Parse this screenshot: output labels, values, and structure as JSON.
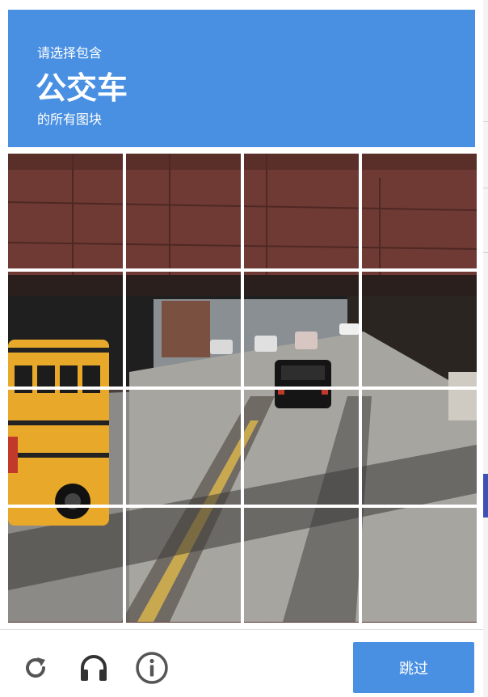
{
  "challenge": {
    "instruction_prefix": "请选择包含",
    "target": "公交车",
    "instruction_suffix": "的所有图块"
  },
  "grid": {
    "rows": 4,
    "cols": 4,
    "tiles": [
      {
        "row": 1,
        "col": 1
      },
      {
        "row": 1,
        "col": 2
      },
      {
        "row": 1,
        "col": 3
      },
      {
        "row": 1,
        "col": 4
      },
      {
        "row": 2,
        "col": 1
      },
      {
        "row": 2,
        "col": 2
      },
      {
        "row": 2,
        "col": 3
      },
      {
        "row": 2,
        "col": 4
      },
      {
        "row": 3,
        "col": 1
      },
      {
        "row": 3,
        "col": 2
      },
      {
        "row": 3,
        "col": 3
      },
      {
        "row": 3,
        "col": 4
      },
      {
        "row": 4,
        "col": 1
      },
      {
        "row": 4,
        "col": 2
      },
      {
        "row": 4,
        "col": 3
      },
      {
        "row": 4,
        "col": 4
      }
    ]
  },
  "footer": {
    "reload_icon": "reload-icon",
    "audio_icon": "headphones-icon",
    "info_icon": "info-icon",
    "skip_label": "跳过"
  },
  "colors": {
    "accent": "#4a90e2"
  }
}
